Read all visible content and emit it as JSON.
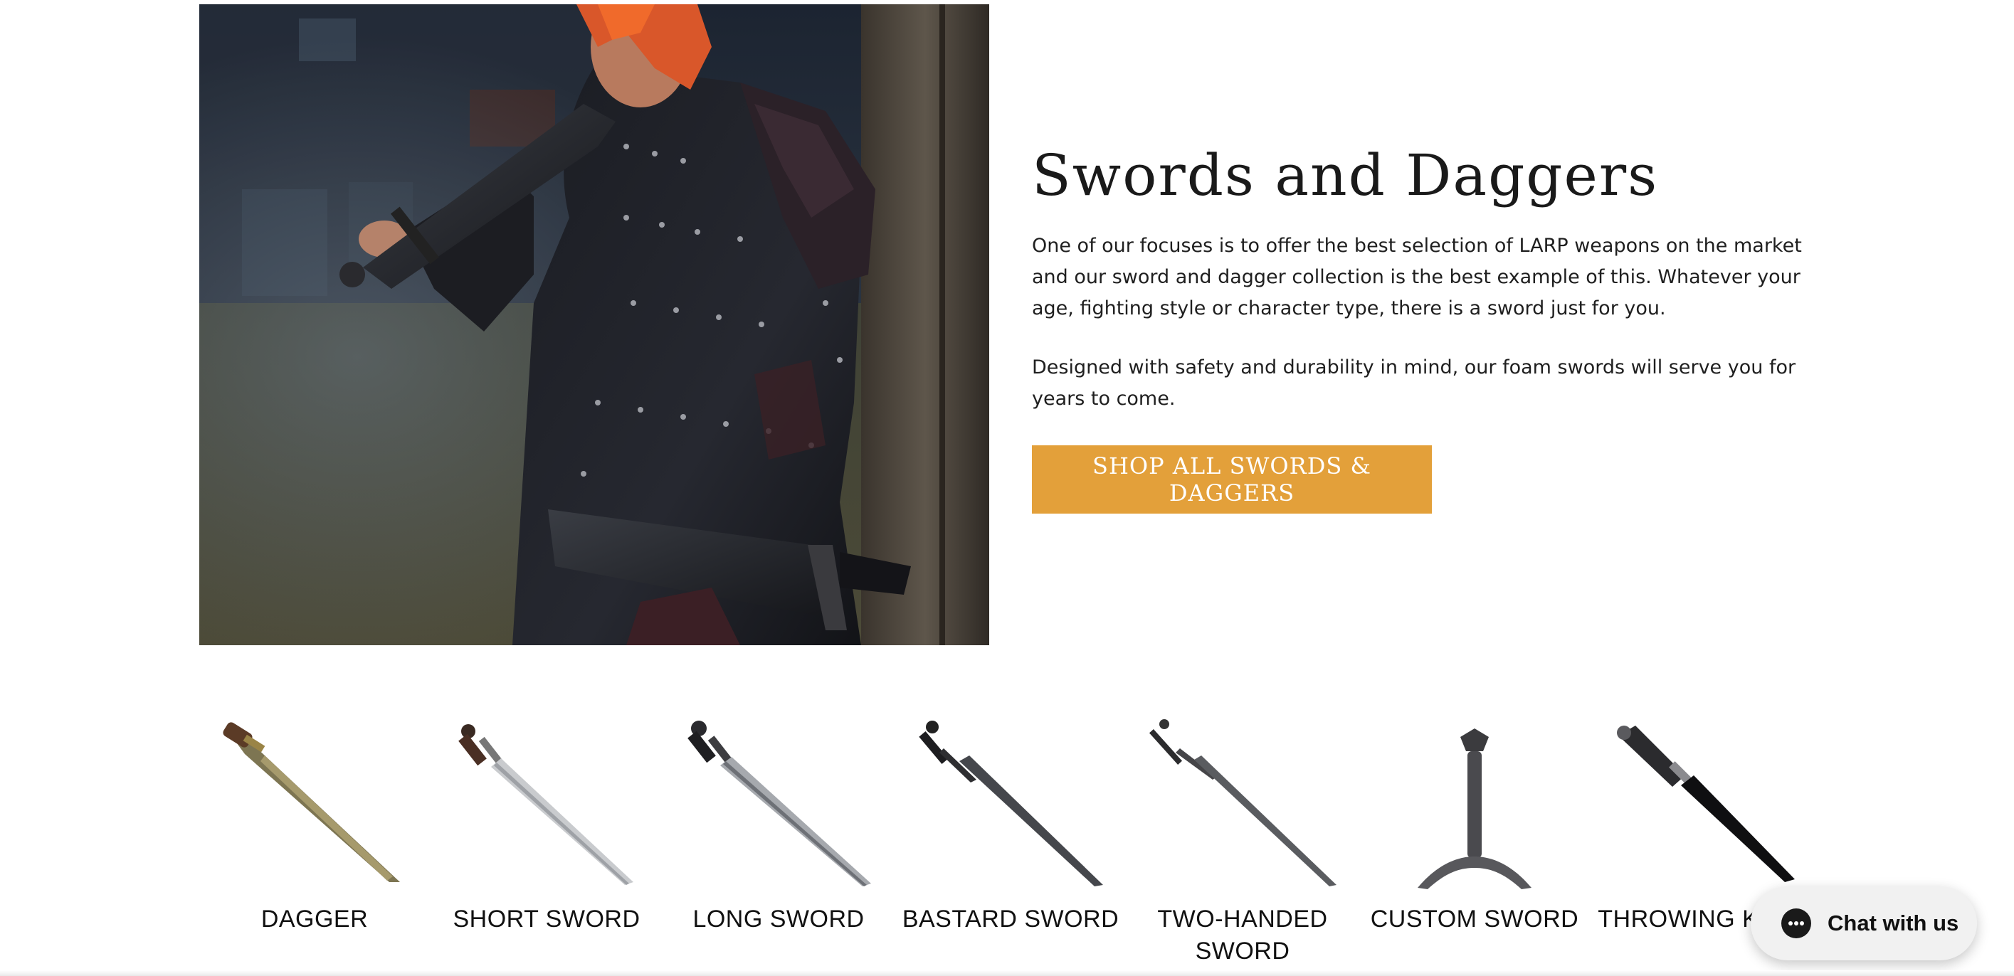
{
  "hero": {
    "title": "Swords and Daggers",
    "paragraph_1": "One of our focuses is to offer the best selection of LARP weapons on the market and our sword and dagger collection is the best example of this. Whatever your age, fighting style or character type, there is a sword just for you.",
    "paragraph_2": "Designed with safety and durability in mind, our foam swords will serve you for years to come.",
    "button_label": "SHOP ALL SWORDS & DAGGERS"
  },
  "categories": [
    {
      "label": "DAGGER",
      "icon": "dagger-icon"
    },
    {
      "label": "SHORT SWORD",
      "icon": "short-sword-icon"
    },
    {
      "label": "LONG SWORD",
      "icon": "long-sword-icon"
    },
    {
      "label": "BASTARD SWORD",
      "icon": "bastard-sword-icon"
    },
    {
      "label": "TWO-HANDED SWORD",
      "icon": "two-handed-sword-icon"
    },
    {
      "label": "CUSTOM SWORD",
      "icon": "custom-sword-icon"
    },
    {
      "label": "THROWING KNIFE",
      "icon": "throwing-knife-icon"
    }
  ],
  "chat": {
    "label": "Chat with us",
    "icon": "chat-bubble-icon"
  },
  "colors": {
    "button_bg": "#e3a03a",
    "text": "#1f1f1f",
    "chat_bg": "#f1f1f1"
  }
}
